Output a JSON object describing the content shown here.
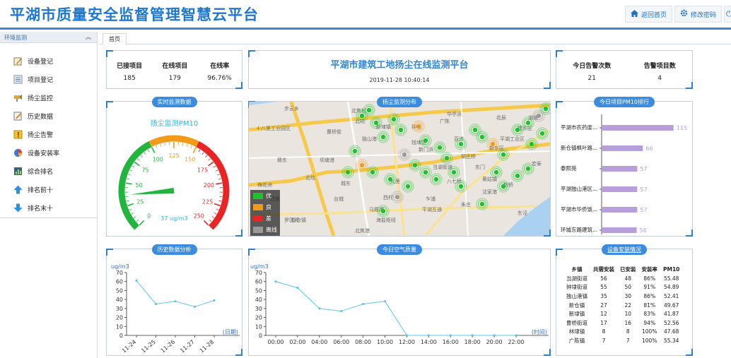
{
  "header": {
    "title": "平湖市质量安全监督管理智慧云平台",
    "home_label": "返回首页",
    "password_label": "修改密码"
  },
  "sidebar": {
    "section_title": "环境监测",
    "items": [
      {
        "label": "设备登记",
        "icon": "edit-icon"
      },
      {
        "label": "项目登记",
        "icon": "list-icon"
      },
      {
        "label": "扬尘监控",
        "icon": "camera-icon"
      },
      {
        "label": "历史数据",
        "icon": "history-icon"
      },
      {
        "label": "扬尘告警",
        "icon": "alert-icon"
      },
      {
        "label": "设备安装率",
        "icon": "pie-icon"
      },
      {
        "label": "综合排名",
        "icon": "ranking-icon"
      },
      {
        "label": "排名前十",
        "icon": "arrow-up-icon"
      },
      {
        "label": "排名末十",
        "icon": "arrow-down-icon"
      }
    ]
  },
  "tabs": [
    {
      "label": "首页"
    }
  ],
  "stats_left": {
    "items": [
      {
        "label": "已接项目",
        "value": "185"
      },
      {
        "label": "在线项目",
        "value": "179"
      },
      {
        "label": "在线率",
        "value": "96.76%"
      }
    ]
  },
  "main_title": {
    "title": "平湖市建筑工地扬尘在线监测平台",
    "time": "2019-11-28 10:40:14"
  },
  "stats_right": {
    "items": [
      {
        "label": "今日告警次数",
        "value": "21"
      },
      {
        "label": "告警项目数",
        "value": "4"
      }
    ]
  },
  "gauge": {
    "tag": "实时监测数据",
    "title": "扬尘监测PM10",
    "unit_value": "37 ug/m3",
    "value": 37,
    "ticks": [
      "0",
      "25",
      "50",
      "75",
      "100",
      "125",
      "150",
      "175",
      "200",
      "225",
      "250"
    ],
    "colors": {
      "good": "#21b53d",
      "mid": "#f29a1a",
      "bad": "#e82424"
    }
  },
  "map": {
    "tag": "扬尘监测分布",
    "place_labels": [
      "步云乡",
      "十八里工业园区",
      "曹桥街",
      "独山港",
      "北坟",
      "城东",
      "新埭镇",
      "钟埭",
      "广陈",
      "西村",
      "平湖互通",
      "马厩港",
      "海盐枢纽",
      "新仓镇",
      "梅花洲",
      "西塘",
      "罗区湾",
      "朱庄",
      "当湖街道",
      "黄姑镇",
      "平湖工业区",
      "新东区",
      "建东区",
      "湖塘",
      "花辰",
      "华亭浜",
      "新门浜",
      "北坑",
      "荣庄桥",
      "东门",
      "八七桥",
      "九里",
      "北焦村",
      "坝塘港",
      "赣东",
      "钱埭区",
      "百济",
      "台城",
      "北焦港",
      "东泾",
      "新桥",
      "沈家港",
      "宏泰",
      "乍浦"
    ],
    "legend": [
      {
        "label": "优",
        "color": "#1ec22e"
      },
      {
        "label": "良",
        "color": "#f29a1a"
      },
      {
        "label": "差",
        "color": "#e82424"
      },
      {
        "label": "离线",
        "color": "#9a9a9a"
      }
    ]
  },
  "rank": {
    "tag": "今日项目PM10排行",
    "bar_color": "#b89fdc"
  },
  "history": {
    "tag": "历史数据分析",
    "unit": "ug/m3",
    "xunit": "(日期)"
  },
  "air": {
    "tag": "今日空气质量",
    "unit": "ug/m3",
    "xunit": "(时间)"
  },
  "devices": {
    "tag": "设备安装情况",
    "headers": [
      "乡镇",
      "共需安装",
      "已安装",
      "安装率",
      "PM10"
    ],
    "rows": [
      [
        "当湖街道",
        "56",
        "48",
        "86%",
        "55.48"
      ],
      [
        "钟埭街道",
        "55",
        "50",
        "91%",
        "54.89"
      ],
      [
        "独山港镇",
        "35",
        "30",
        "86%",
        "52.41"
      ],
      [
        "新仓镇",
        "27",
        "22",
        "81%",
        "49.67"
      ],
      [
        "新埭镇",
        "12",
        "10",
        "83%",
        "41.87"
      ],
      [
        "曹桥街道",
        "17",
        "16",
        "94%",
        "52.56"
      ],
      [
        "林埭镇",
        "8",
        "8",
        "100%",
        "47.68"
      ],
      [
        "广陈镇",
        "7",
        "7",
        "100%",
        "55.34"
      ]
    ]
  },
  "chart_data": [
    {
      "type": "bar",
      "orientation": "horizontal",
      "categories": [
        "平湖市农药废...",
        "新仓镇枫叶路...",
        "泰熙苑",
        "平湖独山港区...",
        "平湖市华侨饭...",
        "环城东路建筑..."
      ],
      "values": [
        115,
        66,
        57,
        57,
        57,
        56
      ],
      "xlim": [
        0,
        130
      ]
    },
    {
      "type": "line",
      "x": [
        "11-24",
        "11-25",
        "11-26",
        "11-27",
        "11-28"
      ],
      "values": [
        61,
        35,
        38,
        32,
        39
      ],
      "ylabel": "ug/m3",
      "xlabel": "(日期)",
      "ylim": [
        0,
        70
      ],
      "yticks": [
        "0",
        "10",
        "20",
        "30",
        "40",
        "50",
        "60",
        "70"
      ]
    },
    {
      "type": "line",
      "x": [
        "00:00",
        "02:00",
        "04:00",
        "06:00",
        "08:00",
        "10:00",
        "12:00",
        "14:00",
        "16:00",
        "18:00",
        "20:00",
        "22:00"
      ],
      "x_values": [
        0,
        2,
        4,
        6,
        8,
        10,
        12,
        14,
        16,
        18,
        20,
        22
      ],
      "points": [
        [
          0,
          60
        ],
        [
          2,
          53
        ],
        [
          4,
          30
        ],
        [
          6,
          27
        ],
        [
          8,
          35
        ],
        [
          10,
          38
        ],
        [
          12,
          0
        ],
        [
          14,
          0
        ],
        [
          16,
          0
        ],
        [
          18,
          0
        ],
        [
          20,
          0
        ],
        [
          22,
          0
        ]
      ],
      "ylabel": "ug/m3",
      "xlabel": "(时间)",
      "ylim": [
        0,
        70
      ],
      "yticks": [
        "0",
        "10",
        "20",
        "30",
        "40",
        "50",
        "60",
        "70"
      ]
    }
  ]
}
